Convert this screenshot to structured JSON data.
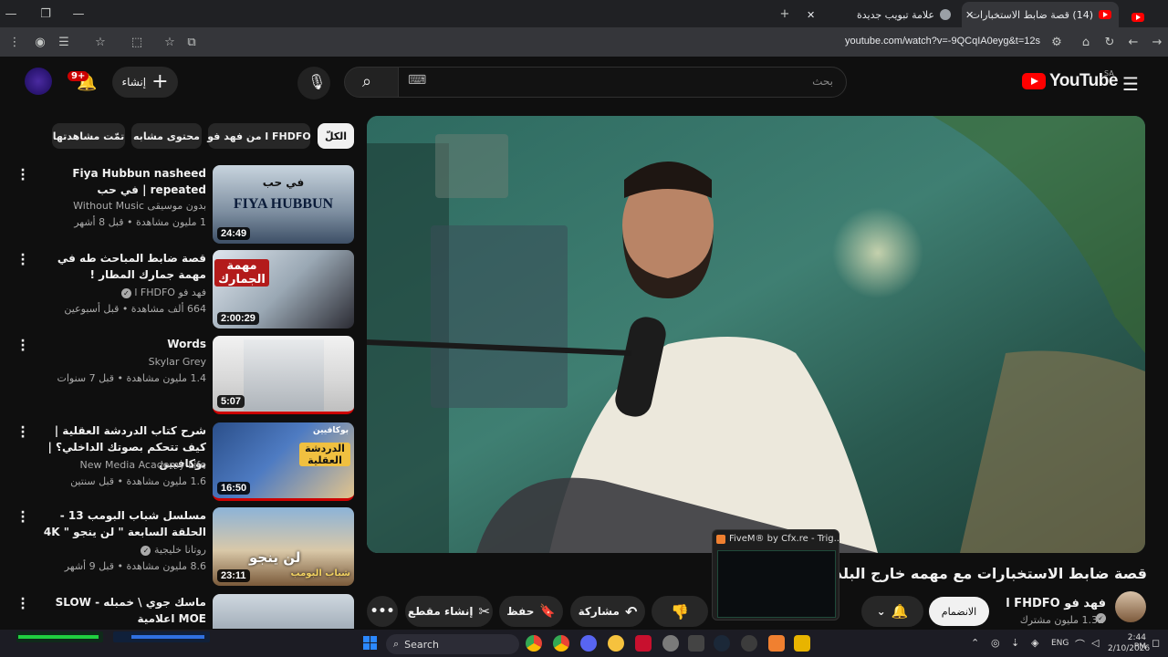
{
  "browser": {
    "tabs": [
      {
        "label": "(14) قصة ضابط الاستخبارات",
        "active": true
      },
      {
        "label": "علامة تبويب جديدة",
        "active": false
      }
    ],
    "url": "youtube.com/watch?v=-9QCqIA0eyg&t=12s"
  },
  "header": {
    "logo_text": "YouTube",
    "region": "SA",
    "search_placeholder": "بحث",
    "create_label": "إنشاء",
    "notif_count": "9+"
  },
  "chips": [
    "الكلّ",
    "من فهد فو l FHDFO",
    "محتوى مشابه",
    "تمّت مشاهدتها"
  ],
  "videos": [
    {
      "title": "Fiya Hubbun nasheed repeated | في حب",
      "channel": "بدون موسيقى Without Music",
      "meta": "1 مليون مشاهدة • قبل 8 أشهر",
      "duration": "24:49",
      "thumb_text": "FIYA HUBBUN",
      "thumb_sub": "في حب"
    },
    {
      "title": "قصة ضابط المباحث طه في مهمة جمارك المطار !",
      "channel": "فهد فو l FHDFO",
      "meta": "664 ألف مشاهدة • قبل أسبوعين",
      "duration": "2:00:29",
      "thumb_text": "مهمة الجمارك",
      "thumb_sub": ""
    },
    {
      "title": "Words",
      "channel": "Skylar Grey",
      "meta": "1.4 مليون مشاهدة • قبل 7 سنوات",
      "duration": "5:07",
      "thumb_text": "",
      "thumb_sub": ""
    },
    {
      "title": "شرح كتاب الدردشة العقلية | كيف تتحكم بصوتك الداخلي؟ | بوكافيين",
      "channel": "New Media Academy Life",
      "meta": "1.6 مليون مشاهدة • قبل سنتين",
      "duration": "16:50",
      "thumb_text": "الدردشة العقلية",
      "thumb_sub": "بوكافيين"
    },
    {
      "title": "مسلسل شباب البومب 13 - الحلقة السابعة \" لن ينجو \" 4K",
      "channel": "روتانا خليجية",
      "meta": "8.6 مليون مشاهدة • قبل 9 أشهر",
      "duration": "23:11",
      "thumb_text": "لن ينجو",
      "thumb_sub": "شباب البومب"
    },
    {
      "title": "ماسك جوي \\ خمبله - SLOW MOE اعلامية",
      "channel": "",
      "meta": "",
      "duration": "",
      "thumb_text": "",
      "thumb_sub": ""
    }
  ],
  "main": {
    "title": "قصة ضابط الاستخبارات مع مهمه خارج البلد !",
    "channel_name": "فهد فو l FHDFO",
    "subscribers": "1.32 مليون مشترك",
    "subscribe_label": "الانضمام",
    "share_label": "مشاركة",
    "save_label": "حفظ",
    "clip_label": "إنشاء مقطع"
  },
  "popup": {
    "label": "FiveM® by Cfx.re - Trig..."
  },
  "taskbar": {
    "search_label": "Search",
    "lang": "ENG",
    "time": "2:44 PM",
    "date": "2/10/2026"
  },
  "colors": {
    "yt_red": "#ff0000",
    "bg": "#0f0f0f",
    "chip": "#272727",
    "text": "#f1f1f1",
    "secondary": "#aaaaaa"
  }
}
